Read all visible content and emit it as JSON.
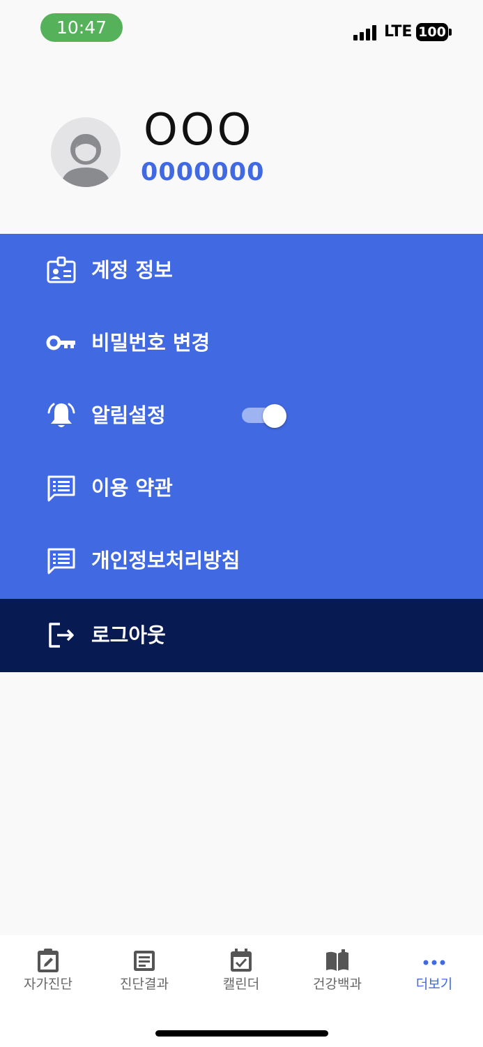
{
  "status_bar": {
    "time": "10:47",
    "network": "LTE",
    "battery": "100"
  },
  "profile": {
    "name": "OOO",
    "id": "0000000"
  },
  "menu": {
    "items": [
      {
        "label": "계정 정보",
        "icon": "id-card-icon"
      },
      {
        "label": "비밀번호 변경",
        "icon": "key-icon"
      },
      {
        "label": "알림설정",
        "icon": "bell-icon",
        "toggle_on": true
      },
      {
        "label": "이용 약관",
        "icon": "document-chat-icon"
      },
      {
        "label": "개인정보처리방침",
        "icon": "document-chat-icon"
      }
    ],
    "logout": {
      "label": "로그아웃",
      "icon": "logout-icon"
    }
  },
  "tabbar": {
    "tabs": [
      {
        "label": "자가진단",
        "icon": "clipboard-edit-icon"
      },
      {
        "label": "진단결과",
        "icon": "note-icon"
      },
      {
        "label": "캘린더",
        "icon": "calendar-check-icon"
      },
      {
        "label": "건강백과",
        "icon": "book-icon"
      },
      {
        "label": "더보기",
        "icon": "more-dots-icon",
        "active": true
      }
    ]
  },
  "colors": {
    "primary": "#4169e1",
    "logout_bg": "#081a52",
    "time_pill": "#55b25b",
    "background": "#f9f9f9"
  }
}
